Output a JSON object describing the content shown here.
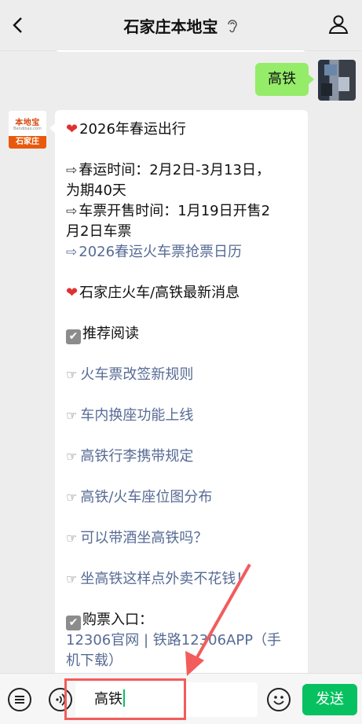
{
  "header": {
    "title": "石家庄本地宝",
    "back_icon": "back-chevron-icon",
    "ear_icon": "ear-icon",
    "profile_icon": "user-icon"
  },
  "chat": {
    "outgoing": {
      "text": "高铁"
    },
    "incoming_avatar": {
      "logo_text": "本地宝",
      "logo_domain": "Bendibao.com",
      "band_text": "石家庄"
    },
    "incoming": {
      "lines": [
        {
          "icon": "❤️",
          "text": "2026年春运出行",
          "link": false
        },
        {
          "icon": "⇨",
          "text": "春运时间：2月2日-3月13日，",
          "link": false
        },
        {
          "icon": "",
          "text": "为期40天",
          "link": false
        },
        {
          "icon": "⇨",
          "text": "车票开售时间：1月19日开售2",
          "link": false
        },
        {
          "icon": "",
          "text": "月2日车票",
          "link": false
        },
        {
          "icon": "⇨",
          "text": "2026春运火车票抢票日历",
          "link": true
        },
        {
          "icon": "❤️",
          "text": "石家庄火车/高铁最新消息",
          "link": false
        },
        {
          "icon": "✔",
          "text": "推荐阅读",
          "link": false
        },
        {
          "icon": "☞",
          "text": "火车票改签新规则",
          "link": true
        },
        {
          "icon": "☞",
          "text": "车内换座功能上线",
          "link": true
        },
        {
          "icon": "☞",
          "text": "高铁行李携带规定",
          "link": true
        },
        {
          "icon": "☞",
          "text": "高铁/火车座位图分布",
          "link": true
        },
        {
          "icon": "☞",
          "text": "可以带酒坐高铁吗？",
          "link": true
        },
        {
          "icon": "☞",
          "text": "坐高铁这样点外卖不花钱！",
          "link": true
        },
        {
          "icon": "✔",
          "text": "购票入口：",
          "link": false
        },
        {
          "icon": "",
          "text": "12306官网 | 铁路12306APP（手",
          "link": true
        },
        {
          "icon": "",
          "text": "机下载）",
          "link": true
        }
      ]
    }
  },
  "input_bar": {
    "value": "高铁",
    "send_label": "发送",
    "menu_icon": "menu-list-icon",
    "voice_icon": "voice-icon",
    "emoji_icon": "emoji-icon"
  },
  "colors": {
    "bubble_out": "#95ec69",
    "send": "#07c160",
    "link": "#576b95",
    "annotation": "#f25c5c"
  }
}
